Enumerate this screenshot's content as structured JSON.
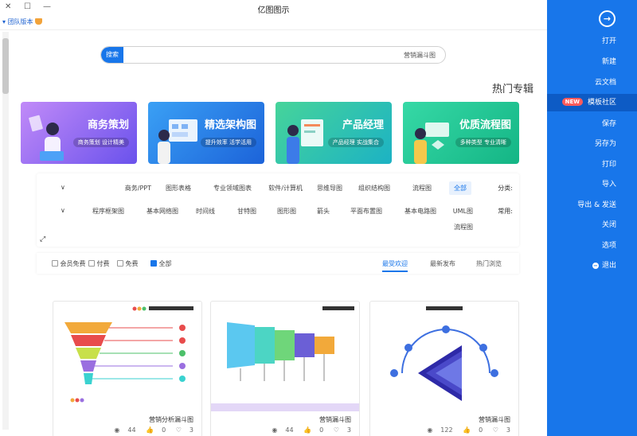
{
  "window": {
    "title": "亿图图示",
    "team_label": "团队版本",
    "close": "✕",
    "restore": "☐",
    "minimize": "—"
  },
  "sidebar": {
    "back_icon": "arrow-right-circle-icon",
    "items": [
      {
        "label": "打开"
      },
      {
        "label": "新建"
      },
      {
        "label": "云文档"
      },
      {
        "label": "模板社区",
        "badge": "NEW",
        "active": true
      },
      {
        "label": "保存"
      },
      {
        "label": "另存为"
      },
      {
        "label": "打印"
      },
      {
        "label": "导入"
      },
      {
        "label": "导出 & 发送"
      },
      {
        "label": "关闭"
      },
      {
        "label": "选项"
      },
      {
        "label": "退出"
      }
    ]
  },
  "search": {
    "button": "搜索",
    "value": "营销漏斗图"
  },
  "section_title": "热门专辑",
  "banners": [
    {
      "title": "优质流程图",
      "subtitle": "多种类型 专业清晰",
      "color_a": "#2ed6a7",
      "color_b": "#18b67e"
    },
    {
      "title": "产品经理",
      "subtitle": "产品经理 实战集合",
      "color_a": "#3ecf9a",
      "color_b": "#1aa9c8"
    },
    {
      "title": "精选架构图",
      "subtitle": "提升效率 活学活用",
      "color_a": "#2b8ff2",
      "color_b": "#1c62d8"
    },
    {
      "title": "商务策划",
      "subtitle": "商务策划 设计精美",
      "color_a": "#b37cf7",
      "color_b": "#6d55ee"
    }
  ],
  "categories": {
    "label": "分类:",
    "items": [
      "全部",
      "流程图",
      "组织结构图",
      "思维导图",
      "软件/计算机",
      "专业领域图表",
      "图形表格",
      "商务/PPT"
    ],
    "common_label": "常用:",
    "common_items": [
      "UML图",
      "基本电路图",
      "平面布置图",
      "箭头",
      "图形图",
      "甘特图",
      "时间线",
      "基本网络图",
      "程序框架图",
      "流程图"
    ]
  },
  "sort": {
    "options": [
      "热门浏览",
      "最新发布",
      "最受欢迎"
    ],
    "filters": [
      "全部",
      "免费",
      "付费",
      "会员免费"
    ]
  },
  "templates": [
    {
      "name": "营销漏斗图",
      "views": "122",
      "likes": "0",
      "favs": "3"
    },
    {
      "name": "营销漏斗图",
      "views": "44",
      "likes": "0",
      "favs": "3"
    },
    {
      "name": "营销分析漏斗图",
      "views": "44",
      "likes": "0",
      "favs": "3"
    }
  ]
}
